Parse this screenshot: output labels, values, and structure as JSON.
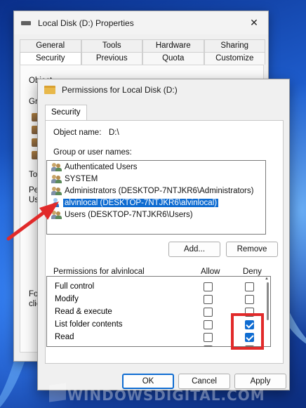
{
  "properties": {
    "title": "Local Disk (D:) Properties",
    "close": "✕",
    "tabs_back": [
      "General",
      "Tools",
      "Hardware",
      "Sharing"
    ],
    "tabs_front": [
      "Security",
      "Previous Versions",
      "Quota",
      "Customize"
    ],
    "active_tab": "Security",
    "fragments": [
      "Object",
      "Gr",
      "To",
      "Pe",
      "Us",
      "Fo",
      "clic"
    ]
  },
  "permissions_dialog": {
    "title": "Permissions for Local Disk (D:)",
    "tab": "Security",
    "object_name_label": "Object name:",
    "object_name_value": "D:\\",
    "group_label": "Group or user names:",
    "users": [
      {
        "name": "Authenticated Users",
        "type": "group"
      },
      {
        "name": "SYSTEM",
        "type": "group"
      },
      {
        "name": "Administrators (DESKTOP-7NTJKR6\\Administrators)",
        "type": "group"
      },
      {
        "name": "alvinlocal (DESKTOP-7NTJKR6\\alvinlocal)",
        "type": "user",
        "selected": true
      },
      {
        "name": "Users (DESKTOP-7NTJKR6\\Users)",
        "type": "group"
      }
    ],
    "add_button": "Add...",
    "remove_button": "Remove",
    "permissions_label": "Permissions for alvinlocal",
    "allow_header": "Allow",
    "deny_header": "Deny",
    "permissions": [
      {
        "name": "Full control",
        "allow": false,
        "deny": false
      },
      {
        "name": "Modify",
        "allow": false,
        "deny": false
      },
      {
        "name": "Read & execute",
        "allow": false,
        "deny": false
      },
      {
        "name": "List folder contents",
        "allow": false,
        "deny": true
      },
      {
        "name": "Read",
        "allow": false,
        "deny": true
      }
    ],
    "ok_button": "OK",
    "cancel_button": "Cancel",
    "apply_button": "Apply"
  },
  "watermark": "WINDOWSDIGITAL.COM",
  "colors": {
    "accent": "#0f6cd1",
    "annotation_red": "#e12a2a"
  }
}
